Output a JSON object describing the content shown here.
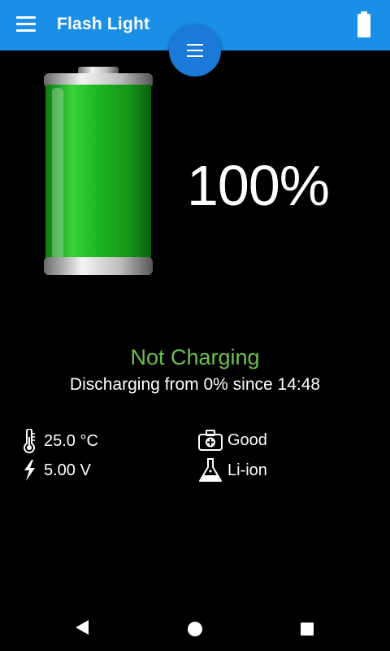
{
  "appbar": {
    "title": "Flash Light",
    "background": "#1a8fe8",
    "icons": [
      "menu-icon",
      "battery-icon"
    ]
  },
  "fab": {
    "icon": "menu-icon",
    "color": "#1b7ad9"
  },
  "battery": {
    "level_percent": 100,
    "percent_text": "100%",
    "fill_color": "#1db520"
  },
  "status": {
    "state": "Not Charging",
    "state_color": "#6cbf4d",
    "detail": "Discharging from 0% since 14:48"
  },
  "stats": {
    "temperature": {
      "icon": "thermometer-icon",
      "value": "25.0 °C"
    },
    "voltage": {
      "icon": "lightning-icon",
      "value": "5.00 V"
    },
    "health": {
      "icon": "first-aid-kit-icon",
      "value": "Good"
    },
    "technology": {
      "icon": "flask-icon",
      "value": "Li-ion"
    }
  },
  "navbar": {
    "icons": [
      "back-icon",
      "home-icon",
      "recents-icon"
    ]
  }
}
